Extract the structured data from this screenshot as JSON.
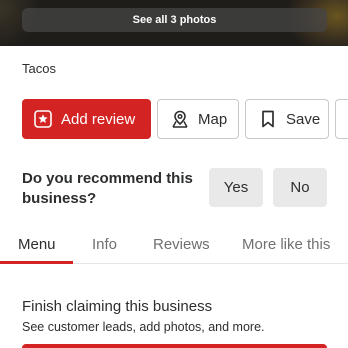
{
  "hero": {
    "see_all_label": "See all 3 photos"
  },
  "business": {
    "category": "Tacos"
  },
  "actions": {
    "add_review_label": "Add review",
    "map_label": "Map",
    "save_label": "Save"
  },
  "recommend": {
    "question": "Do you recommend this business?",
    "yes_label": "Yes",
    "no_label": "No"
  },
  "tabs": [
    {
      "label": "Menu",
      "active": true
    },
    {
      "label": "Info",
      "active": false
    },
    {
      "label": "Reviews",
      "active": false
    },
    {
      "label": "More like this",
      "active": false
    }
  ],
  "claim": {
    "title": "Finish claiming this business",
    "subtitle": "See customer leads, add photos, and more."
  },
  "colors": {
    "brand_red": "#d32323",
    "text": "#2d2e2f",
    "muted_text": "#6e7072",
    "chip_bg": "#e9e9ea"
  },
  "icons": {
    "add_review": "star-box-icon",
    "map": "map-pin-icon",
    "save": "bookmark-icon"
  }
}
